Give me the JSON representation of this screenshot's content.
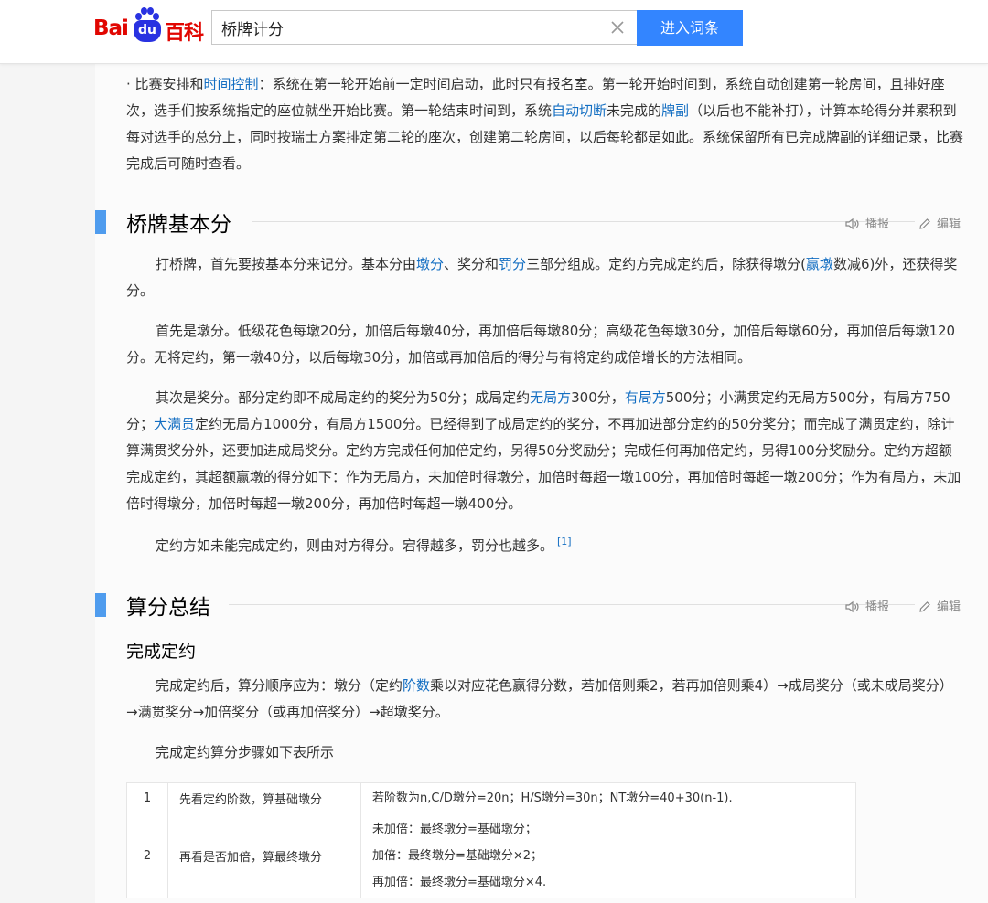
{
  "header": {
    "logo": {
      "bai": "Bai",
      "du": "du",
      "baike": "百科"
    },
    "search_value": "桥牌计分",
    "search_button": "进入词条"
  },
  "intro": {
    "p1": [
      {
        "t": "· 比赛安排和"
      },
      {
        "t": "时间控制",
        "link": true
      },
      {
        "t": "：系统在第一轮开始前一定时间启动，此时只有报名室。第一轮开始时间到，系统自动创建第一轮房间，且排好座次，选手们按系统指定的座位就坐开始比赛。第一轮结束时间到，系统"
      },
      {
        "t": "自动切断",
        "link": true
      },
      {
        "t": "未完成的"
      },
      {
        "t": "牌副",
        "link": true
      },
      {
        "t": "（以后也不能补打），计算本轮得分并累积到每对选手的总分上，同时按瑞士方案排定第二轮的座次，创建第二轮房间，以后每轮都是如此。系统保留所有已完成牌副的详细记录，比赛完成后可随时查看。"
      }
    ]
  },
  "section1": {
    "title": "桥牌基本分",
    "actions": {
      "play": "播报",
      "edit": "编辑"
    },
    "p1": [
      {
        "t": "打桥牌，首先要按基本分来记分。基本分由"
      },
      {
        "t": "墩分",
        "link": true
      },
      {
        "t": "、奖分和"
      },
      {
        "t": "罚分",
        "link": true
      },
      {
        "t": "三部分组成。定约方完成定约后，除获得墩分("
      },
      {
        "t": "赢墩",
        "link": true
      },
      {
        "t": "数减6)外，还获得奖分。"
      }
    ],
    "p2": [
      {
        "t": "首先是墩分。低级花色每墩20分，加倍后每墩40分，再加倍后每墩80分；高级花色每墩30分，加倍后每墩60分，再加倍后每墩120分。无将定约，第一墩40分，以后每墩30分，加倍或再加倍后的得分与有将定约成倍增长的方法相同。"
      }
    ],
    "p3": [
      {
        "t": "其次是奖分。部分定约即不成局定约的奖分为50分；成局定约"
      },
      {
        "t": "无局方",
        "link": true
      },
      {
        "t": "300分，"
      },
      {
        "t": "有局方",
        "link": true
      },
      {
        "t": "500分；小满贯定约无局方500分，有局方750分；"
      },
      {
        "t": "大满贯",
        "link": true
      },
      {
        "t": "定约无局方1000分，有局方1500分。已经得到了成局定约的奖分，不再加进部分定约的50分奖分；而完成了满贯定约，除计算满贯奖分外，还要加进成局奖分。定约方完成任何加倍定约，另得50分奖励分；完成任何再加倍定约，另得100分奖励分。定约方超额完成定约，其超额赢墩的得分如下：作为无局方，未加倍时得墩分，加倍时每超一墩100分，再加倍时每超一墩200分；作为有局方，未加倍时得墩分，加倍时每超一墩200分，再加倍时每超一墩400分。"
      }
    ],
    "p4": [
      {
        "t": "定约方如未能完成定约，则由对方得分。宕得越多，罚分也越多。"
      }
    ],
    "ref": "[1]"
  },
  "section2": {
    "title": "算分总结",
    "actions": {
      "play": "播报",
      "edit": "编辑"
    },
    "subtitle": "完成定约",
    "p1": [
      {
        "t": "完成定约后，算分顺序应为：墩分（定约"
      },
      {
        "t": "阶数",
        "link": true
      },
      {
        "t": "乘以对应花色赢得分数，若加倍则乘2，若再加倍则乘4）→成局奖分（或未成局奖分）→满贯奖分→加倍奖分（或再加倍奖分）→超墩奖分。"
      }
    ],
    "p2": [
      {
        "t": "完成定约算分步骤如下表所示"
      }
    ],
    "table": [
      {
        "no": "1",
        "step": "先看定约阶数，算基础墩分",
        "detail": [
          "若阶数为n,C/D墩分=20n；H/S墩分=30n；NT墩分=40+30(n-1)."
        ]
      },
      {
        "no": "2",
        "step": "再看是否加倍，算最终墩分",
        "detail": [
          "未加倍：最终墩分=基础墩分；",
          "加倍：最终墩分=基础墩分×2；",
          "再加倍：最终墩分=基础墩分×4."
        ]
      }
    ]
  }
}
